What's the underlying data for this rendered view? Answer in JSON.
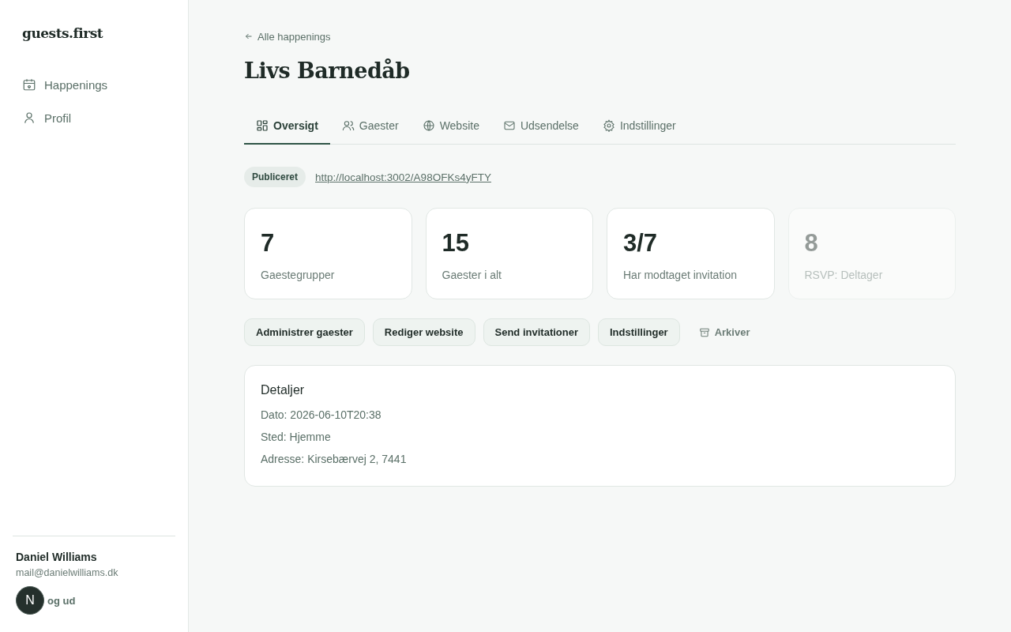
{
  "sidebar": {
    "logo": "guests.first",
    "items": [
      {
        "label": "Happenings",
        "selected": false
      },
      {
        "label": "Profil",
        "selected": false
      }
    ],
    "user": {
      "name": "Daniel Williams",
      "email": "mail@danielwilliams.dk",
      "logout": "og ud"
    },
    "dev_badge": {
      "label": "N"
    }
  },
  "back_link": "Alle happenings",
  "title": "Livs Barnedåb",
  "tabs": [
    {
      "label": "Oversigt",
      "selected": true
    },
    {
      "label": "Gaester",
      "selected": false
    },
    {
      "label": "Website",
      "selected": false
    },
    {
      "label": "Udsendelse",
      "selected": false
    },
    {
      "label": "Indstillinger",
      "selected": false
    }
  ],
  "status": {
    "badge": "Publiceret",
    "url": "http://localhost:3002/A98OFKs4yFTY"
  },
  "stats": [
    {
      "value": "7",
      "label": "Gaestegrupper",
      "faded": false
    },
    {
      "value": "15",
      "label": "Gaester i alt",
      "faded": false
    },
    {
      "value": "3/7",
      "label": "Har modtaget invitation",
      "faded": false
    },
    {
      "value": "8",
      "label": "RSVP: Deltager",
      "faded": true
    }
  ],
  "actions": [
    {
      "label": "Administrer gaester",
      "kind": "button"
    },
    {
      "label": "Rediger website",
      "kind": "button"
    },
    {
      "label": "Send invitationer",
      "kind": "button"
    },
    {
      "label": "Indstillinger",
      "kind": "button"
    },
    {
      "label": "Arkiver",
      "kind": "archive"
    }
  ],
  "details": {
    "title": "Detaljer",
    "lines": [
      "Dato: 2026-06-10T20:38",
      "Sted: Hjemme",
      "Adresse: Kirsebærvej 2, 7441"
    ]
  }
}
